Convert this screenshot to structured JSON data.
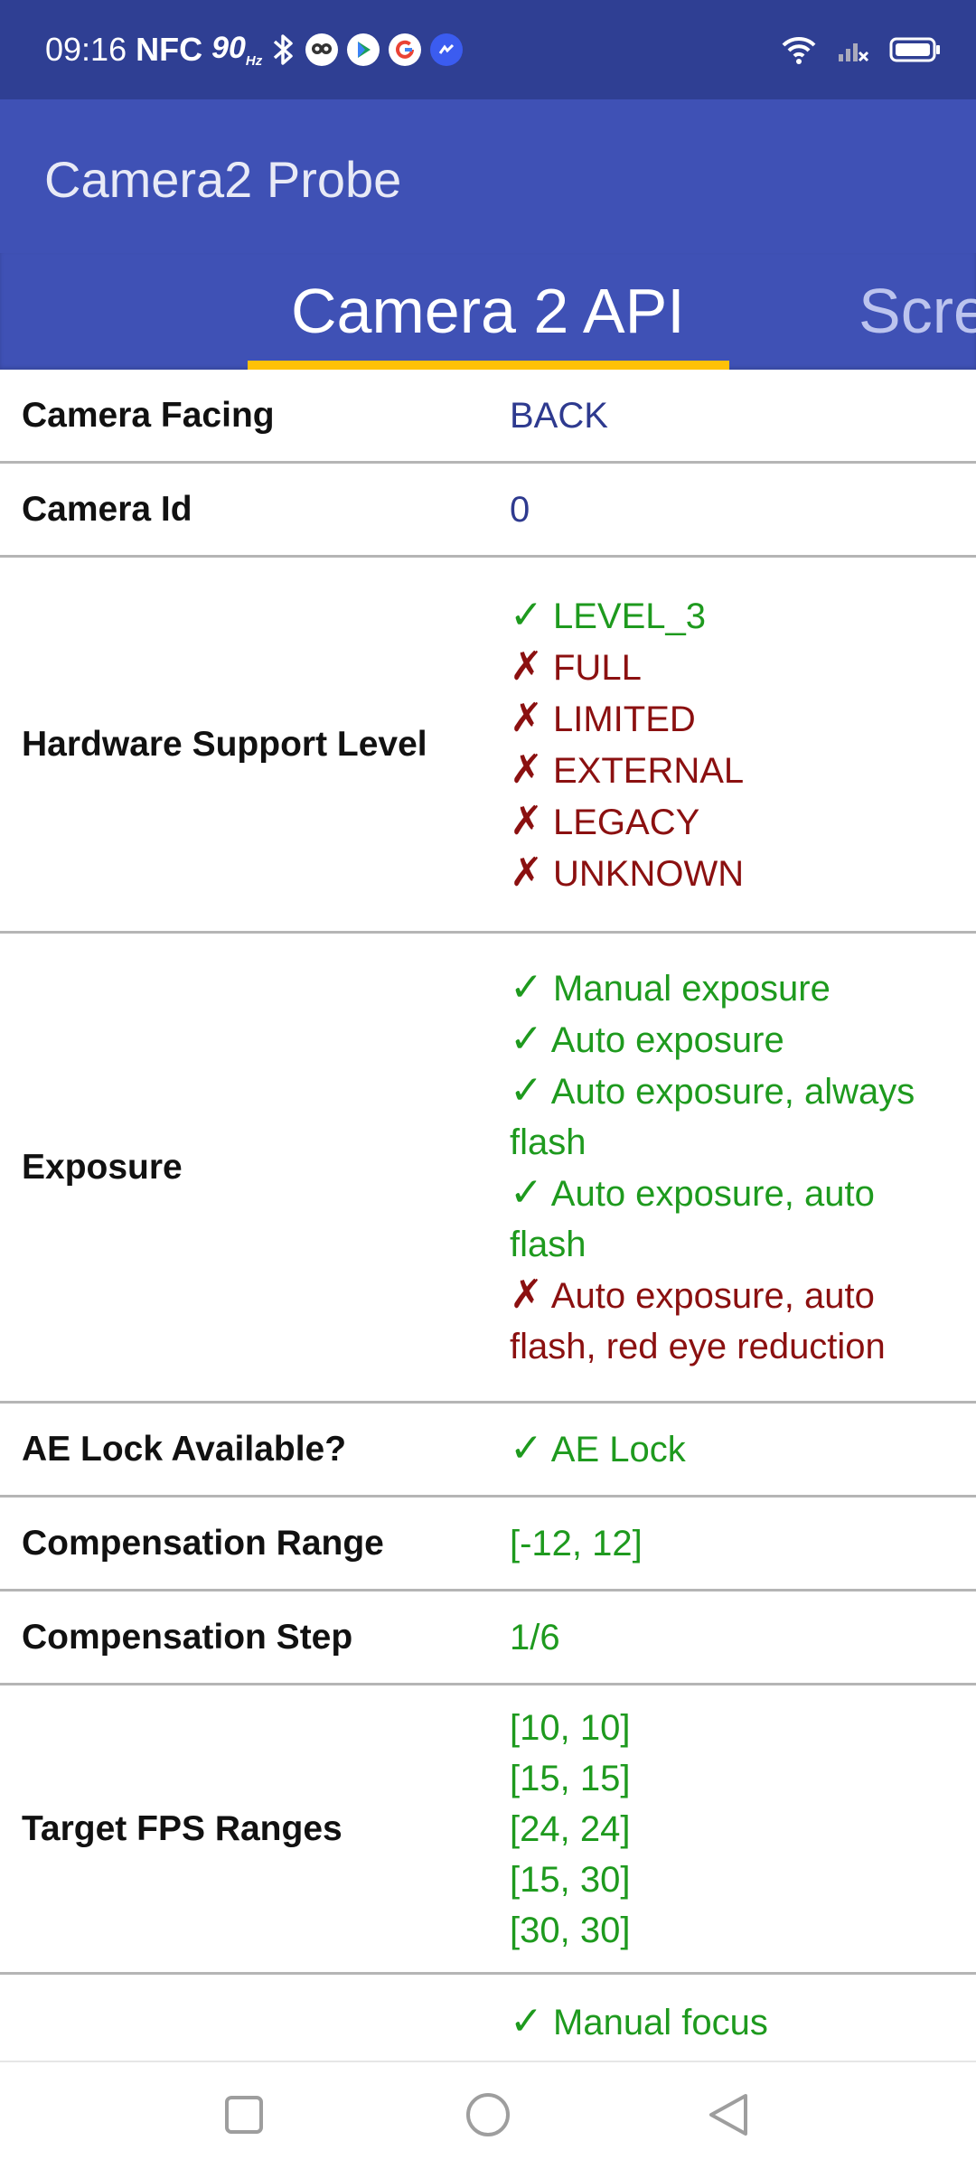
{
  "status": {
    "time": "09:16",
    "nfc": "NFC",
    "refresh": "90",
    "refresh_unit": "Hz"
  },
  "app": {
    "title": "Camera2 Probe"
  },
  "tabs": [
    {
      "label": "Camera 2 API",
      "active": true
    },
    {
      "label": "Scre",
      "active": false
    }
  ],
  "colors": {
    "status_bar": "#2f3f93",
    "app_bar": "#3f51b5",
    "indicator": "#ffc107",
    "supported": "#1e9a1e",
    "unsupported": "#8b1010"
  },
  "rows": [
    {
      "label": "Camera Facing",
      "values": [
        {
          "text": "BACK"
        }
      ]
    },
    {
      "label": "Camera Id",
      "values": [
        {
          "text": "0"
        }
      ]
    },
    {
      "label": "Hardware Support Level",
      "values": [
        {
          "mark": "✓",
          "text": "LEVEL_3"
        },
        {
          "mark": "✗",
          "text": "FULL"
        },
        {
          "mark": "✗",
          "text": "LIMITED"
        },
        {
          "mark": "✗",
          "text": "EXTERNAL"
        },
        {
          "mark": "✗",
          "text": "LEGACY"
        },
        {
          "mark": "✗",
          "text": "UNKNOWN"
        }
      ]
    },
    {
      "label": "Exposure",
      "values": [
        {
          "mark": "✓",
          "text": "Manual exposure"
        },
        {
          "mark": "✓",
          "text": "Auto exposure"
        },
        {
          "mark": "✓",
          "text": "Auto exposure, always flash"
        },
        {
          "mark": "✓",
          "text": "Auto exposure, auto flash"
        },
        {
          "mark": "✗",
          "text": "Auto exposure, auto flash, red eye reduction"
        }
      ]
    },
    {
      "label": "AE Lock Available?",
      "values": [
        {
          "mark": "✓",
          "text": "AE Lock"
        }
      ]
    },
    {
      "label": "Compensation Range",
      "values": [
        {
          "text": "[-12, 12]"
        }
      ]
    },
    {
      "label": "Compensation Step",
      "values": [
        {
          "text": "1/6"
        }
      ]
    },
    {
      "label": "Target FPS Ranges",
      "values": [
        {
          "text": "[10, 10]"
        },
        {
          "text": "[15, 15]"
        },
        {
          "text": "[24, 24]"
        },
        {
          "text": "[15, 30]"
        },
        {
          "text": "[30, 30]"
        }
      ]
    },
    {
      "label": "",
      "values": [
        {
          "mark": "✓",
          "text": "Manual focus"
        }
      ]
    }
  ],
  "nav": {
    "recents": "recents-icon",
    "home": "home-icon",
    "back": "back-icon"
  }
}
